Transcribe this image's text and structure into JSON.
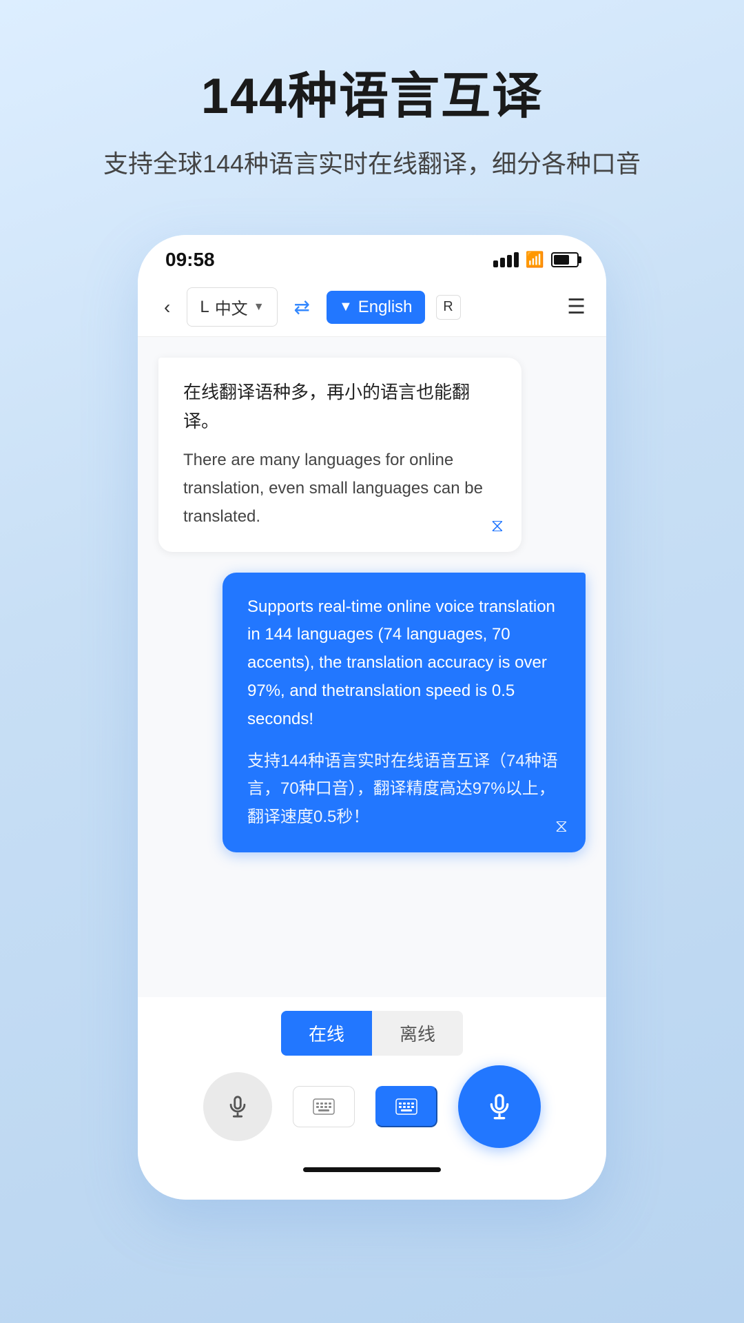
{
  "page": {
    "title": "144种语言互译",
    "subtitle": "支持全球144种语言实时在线翻译，细分各种口音"
  },
  "status_bar": {
    "time": "09:58"
  },
  "toolbar": {
    "back_label": "<",
    "left_lang_prefix": "L",
    "left_lang": "中文",
    "swap": "⇄",
    "right_lang": "English",
    "right_lang_suffix": "R",
    "menu": "☰"
  },
  "chat": {
    "bubble_left": {
      "text_zh": "在线翻译语种多，再小的语言也能翻译。",
      "text_en": "There are many languages for online translation, even small languages can be translated."
    },
    "bubble_right": {
      "text_en": "Supports real-time online voice translation in 144 languages (74 languages, 70 accents), the translation accuracy is over 97%, and thetranslation speed is 0.5 seconds!",
      "text_zh": "支持144种语言实时在线语音互译（74种语言，70种口音），翻译精度高达97%以上，翻译速度0.5秒！"
    }
  },
  "bottom": {
    "mode_online": "在线",
    "mode_offline": "离线",
    "keyboard_icon": "⌨",
    "keyboard_icon2": "⌨"
  }
}
